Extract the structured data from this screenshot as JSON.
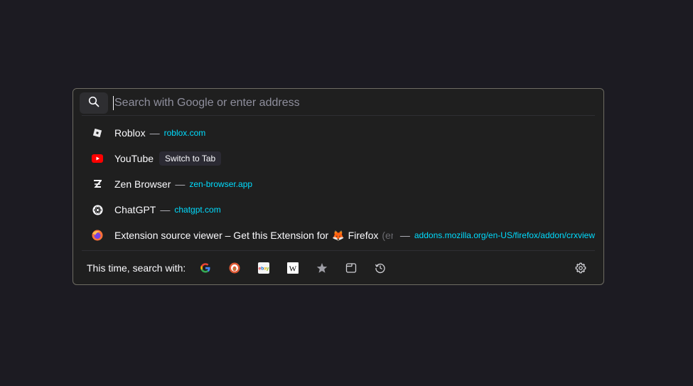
{
  "urlbar": {
    "placeholder": "Search with Google or enter address",
    "value": ""
  },
  "results": [
    {
      "title": "Roblox",
      "separator": "—",
      "url": "roblox.com",
      "icon": "roblox-icon"
    },
    {
      "title": "YouTube",
      "action": "Switch to Tab",
      "icon": "youtube-icon"
    },
    {
      "title": "Zen Browser",
      "separator": "—",
      "url": "zen-browser.app",
      "icon": "zen-icon"
    },
    {
      "title": "ChatGPT",
      "separator": "—",
      "url": "chatgpt.com",
      "icon": "chatgpt-icon"
    },
    {
      "title": "Extension source viewer – Get this Extension for",
      "title_emoji": "🦊",
      "title_rest": "Firefox",
      "title_fade": "(en",
      "separator": "—",
      "url": "addons.mozilla.org/en-US/firefox/addon/crxview",
      "icon": "firefox-icon"
    }
  ],
  "footer": {
    "label": "This time, search with:",
    "engines": [
      "google-icon",
      "duckduckgo-icon",
      "ebay-icon",
      "wikipedia-icon",
      "bookmarks-star-icon",
      "tabs-icon",
      "history-icon"
    ]
  },
  "colors": {
    "background": "#1c1b22",
    "panel": "#1f1f1f",
    "url": "#00ddff",
    "border": "#6e6c63"
  }
}
